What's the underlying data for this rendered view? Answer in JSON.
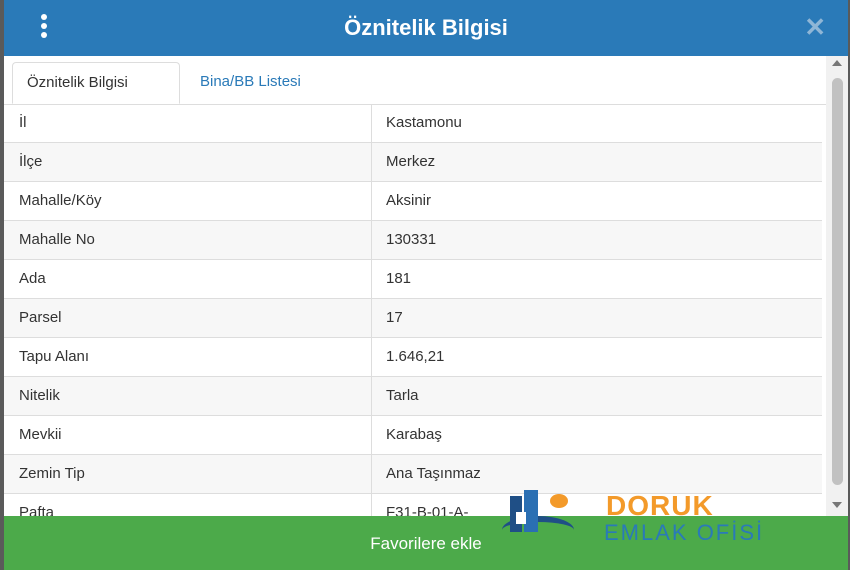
{
  "dialog": {
    "title": "Öznitelik Bilgisi",
    "close_glyph": "✕",
    "menu_icon": "kebab-menu-icon"
  },
  "tabs": [
    {
      "label": "Öznitelik Bilgisi",
      "active": true
    },
    {
      "label": "Bina/BB Listesi",
      "active": false
    }
  ],
  "rows": [
    {
      "key": "İl",
      "value": "Kastamonu"
    },
    {
      "key": "İlçe",
      "value": "Merkez"
    },
    {
      "key": "Mahalle/Köy",
      "value": "Aksinir"
    },
    {
      "key": "Mahalle No",
      "value": "130331"
    },
    {
      "key": "Ada",
      "value": "181"
    },
    {
      "key": "Parsel",
      "value": "17"
    },
    {
      "key": "Tapu Alanı",
      "value": "1.646,21"
    },
    {
      "key": "Nitelik",
      "value": "Tarla"
    },
    {
      "key": "Mevkii",
      "value": "Karabaş"
    },
    {
      "key": "Zemin Tip",
      "value": "Ana Taşınmaz"
    },
    {
      "key": "Pafta",
      "value": "F31-B-01-A-"
    }
  ],
  "footer": {
    "button_label": "Favorilere ekle"
  },
  "watermark": {
    "line1": "DORUK",
    "line2": "EMLAK OFİSİ"
  },
  "colors": {
    "header": "#2a7ab8",
    "footer": "#4caa4a",
    "accent": "#f39a2a"
  }
}
